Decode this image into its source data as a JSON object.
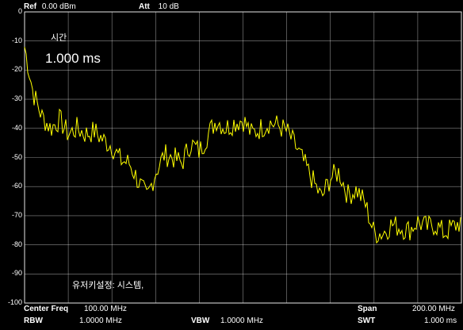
{
  "header": {
    "ref_label": "Ref",
    "ref_value": "0.00 dBm",
    "att_label": "Att",
    "att_value": "10 dB"
  },
  "overlay": {
    "time_label": "시간",
    "time_value": "1.000 ms",
    "message": "유저키설정:  시스템,"
  },
  "footer": {
    "center_freq_label": "Center Freq",
    "center_freq_value": "100.00 MHz",
    "rbw_label": "RBW",
    "rbw_value": "1.0000 MHz",
    "vbw_label": "VBW",
    "vbw_value": "1.0000 MHz",
    "span_label": "Span",
    "span_value": "200.00 MHz",
    "swt_label": "SWT",
    "swt_value": "1.000 ms"
  },
  "colors": {
    "trace": "#ffff00",
    "grid": "#ffffff",
    "background": "#000000"
  },
  "chart_data": {
    "type": "line",
    "ylim": [
      -100,
      0
    ],
    "yticks": [
      "0",
      "-10",
      "-20",
      "-30",
      "-40",
      "-50",
      "-60",
      "-70",
      "-80",
      "-90",
      "-100"
    ],
    "xlim": [
      0,
      200
    ],
    "x_unit_note": "MHz",
    "grid": true,
    "series": [
      {
        "x": [
          0,
          4,
          8,
          12,
          16,
          20,
          24,
          28,
          32,
          36,
          40,
          44,
          48,
          52,
          56,
          60,
          64,
          68,
          72,
          76,
          80,
          84,
          88,
          92,
          96,
          100,
          104,
          108,
          112,
          116,
          120,
          124,
          128,
          132,
          136,
          140,
          144,
          148,
          152,
          156,
          160,
          164,
          168,
          172,
          176,
          180,
          184,
          188,
          192,
          196,
          200
        ],
        "values": [
          -12,
          -28,
          -36,
          -40,
          -37,
          -42,
          -40,
          -42,
          -41,
          -44,
          -46,
          -51,
          -52,
          -58,
          -64,
          -55,
          -49,
          -50,
          -52,
          -45,
          -48,
          -42,
          -37,
          -40,
          -38,
          -37,
          -42,
          -40,
          -38,
          -39,
          -41,
          -46,
          -52,
          -58,
          -64,
          -57,
          -55,
          -63,
          -61,
          -66,
          -76,
          -76,
          -73,
          -74,
          -75,
          -72,
          -74,
          -73,
          -76,
          -74,
          -72
        ]
      }
    ]
  }
}
